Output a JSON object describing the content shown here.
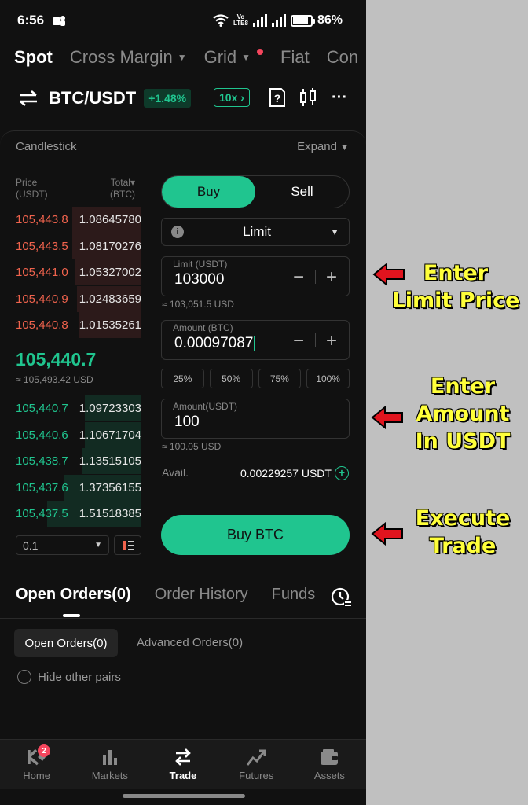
{
  "status": {
    "time": "6:56",
    "network": "Vo LTE8",
    "battery": "86%"
  },
  "top_tabs": [
    {
      "label": "Spot",
      "active": true
    },
    {
      "label": "Cross Margin",
      "caret": true
    },
    {
      "label": "Grid",
      "caret": true,
      "dot": true
    },
    {
      "label": "Fiat"
    },
    {
      "label": "Con"
    }
  ],
  "pair": {
    "name": "BTC/USDT",
    "change": "+1.48%",
    "leverage": "10x"
  },
  "candlestick": {
    "label": "Candlestick",
    "expand": "Expand"
  },
  "orderbook": {
    "price_header": "Price\n(USDT)",
    "total_header": "Total\n(BTC)",
    "asks": [
      {
        "price": "105,443.8",
        "total": "1.08645780",
        "depth": 0.55
      },
      {
        "price": "105,443.5",
        "total": "1.08170276",
        "depth": 0.55
      },
      {
        "price": "105,441.0",
        "total": "1.05327002",
        "depth": 0.53
      },
      {
        "price": "105,440.9",
        "total": "1.02483659",
        "depth": 0.51
      },
      {
        "price": "105,440.8",
        "total": "1.01535261",
        "depth": 0.5
      }
    ],
    "last_price": "105,440.7",
    "last_price_usd": "≈ 105,493.42 USD",
    "bids": [
      {
        "price": "105,440.7",
        "total": "1.09723303",
        "depth": 0.45
      },
      {
        "price": "105,440.6",
        "total": "1.10671704",
        "depth": 0.45
      },
      {
        "price": "105,438.7",
        "total": "1.13515105",
        "depth": 0.47
      },
      {
        "price": "105,437.6",
        "total": "1.37356155",
        "depth": 0.62
      },
      {
        "price": "105,437.5",
        "total": "1.51518385",
        "depth": 0.75
      }
    ],
    "depth_step": "0.1"
  },
  "form": {
    "buy_label": "Buy",
    "sell_label": "Sell",
    "order_type": "Limit",
    "limit_label": "Limit (USDT)",
    "limit_value": "103000",
    "limit_approx": "≈ 103,051.5 USD",
    "amount_label": "Amount (BTC)",
    "amount_value": "0.00097087",
    "percents": [
      "25%",
      "50%",
      "75%",
      "100%"
    ],
    "amount_usdt_label": "Amount(USDT)",
    "amount_usdt_value": "100",
    "amount_usdt_approx": "≈ 100.05 USD",
    "avail_label": "Avail.",
    "avail_value": "0.00229257 USDT",
    "submit_label": "Buy BTC"
  },
  "orders": {
    "tabs": [
      {
        "label": "Open Orders(0)",
        "active": true
      },
      {
        "label": "Order History"
      },
      {
        "label": "Funds"
      }
    ],
    "sub_tabs": [
      "Open Orders(0)",
      "Advanced Orders(0)"
    ],
    "hide_other_pairs": "Hide other pairs"
  },
  "bottom_nav": [
    {
      "label": "Home",
      "icon": "home-icon",
      "badge": "2"
    },
    {
      "label": "Markets",
      "icon": "markets-icon"
    },
    {
      "label": "Trade",
      "icon": "trade-icon",
      "active": true
    },
    {
      "label": "Futures",
      "icon": "futures-icon"
    },
    {
      "label": "Assets",
      "icon": "assets-icon"
    }
  ],
  "annotations": {
    "limit_price": [
      "Enter",
      "Limit Price"
    ],
    "amount": [
      "Enter",
      "Amount",
      "In USDT"
    ],
    "execute": [
      "Execute",
      "Trade"
    ]
  },
  "colors": {
    "green": "#20c58f",
    "red": "#f0634d",
    "callout": "#ffff3a",
    "arrow": "#e0141e"
  }
}
